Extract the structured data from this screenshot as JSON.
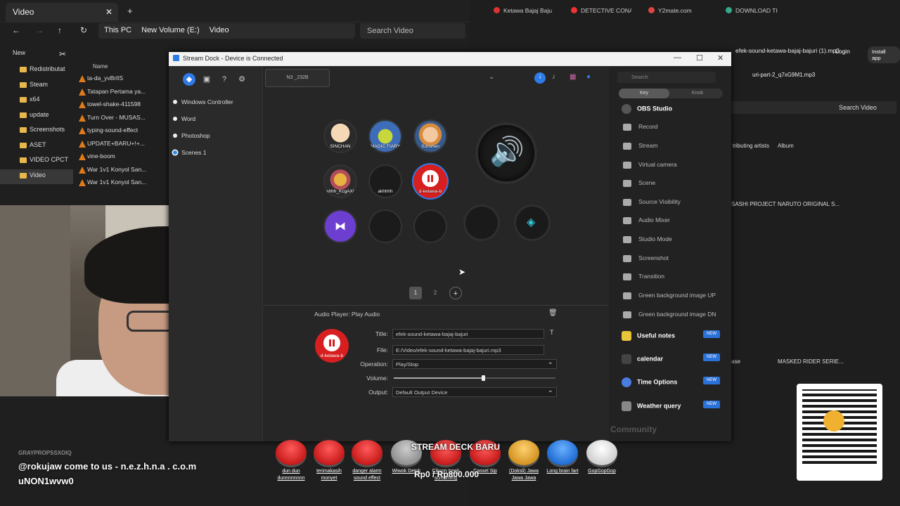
{
  "explorer": {
    "tab": "Video",
    "crumbs": [
      "This PC",
      "New Volume (E:)",
      "Video"
    ],
    "search": "Search Video",
    "new": "New",
    "col_name": "Name",
    "sidebar": [
      "Redistributat",
      "Steam",
      "x64",
      "update",
      "Screenshots",
      "ASET",
      "VIDEO CPCT",
      "Video"
    ],
    "files": [
      "ta-da_yvBrlIS",
      "Tatapan Pertama ya...",
      "towel-shake-411598",
      "Turn Over - MUSAS...",
      "typing-sound-effect",
      "UPDATE+BARU+!+...",
      "vine-boom",
      "War 1v1 Konyol San...",
      "War 1v1 Konyol San..."
    ]
  },
  "chrome": {
    "tabs": [
      "Ketawa Bajaj Baju",
      "DETECTIVE CONA",
      "Y2mate.com",
      "DOWNLOAD TI"
    ],
    "login": "Login",
    "install": "Install app",
    "downloads": [
      "efek-sound-ketawa-bajaj-bajuri (1).mp3",
      "uri-part-2_q7xG9M1.mp3"
    ],
    "search": "Search Video",
    "cols": [
      "tributing artists",
      "Album"
    ],
    "rows": [
      [
        "SASHI PROJECT",
        "NARUTO ORIGINAL S..."
      ],
      [
        "ase",
        "MASKED RIDER SERIE..."
      ]
    ]
  },
  "dock": {
    "title": "Stream Dock - Device is Connected",
    "device": "N3 _232B",
    "profiles": [
      "Windows Controller",
      "Word",
      "Photoshop",
      "Scenes 1"
    ],
    "keys": [
      "SINCHAN",
      "MAGIC FIARY",
      "Sunshen",
      "shhh_KcgAX!",
      "akhhhh",
      "d-ketawa-b"
    ],
    "pages": [
      "1",
      "2",
      "+"
    ],
    "action_header": "Audio Player: Play Audio",
    "props": {
      "title_label": "Title:",
      "title": "efek-sound-ketawa-bajaj-bajuri",
      "file_label": "File:",
      "file": "E:/Video/efek-sound-ketawa-bajaj-bajuri.mp3",
      "op_label": "Operation:",
      "op": "Play/Stop",
      "vol_label": "Volume:",
      "volume": 0.55,
      "out_label": "Output:",
      "output": "Default Output Device"
    },
    "preview_label": "d-ketawa-b",
    "right": {
      "search": "Search",
      "key": "Key",
      "knob": "Knob",
      "section": "OBS Studio",
      "items": [
        "Record",
        "Stream",
        "Virtual camera",
        "Scene",
        "Source Visibility",
        "Audio Mixer",
        "Studio Mode",
        "Screenshot",
        "Transition",
        "Green background image UP",
        "Green background image DN"
      ],
      "cats": [
        "Useful notes",
        "calendar",
        "Time Options",
        "Weather query"
      ],
      "new": "NEW",
      "community": "Community"
    }
  },
  "overlay": {
    "chat_user": "GRAYPROPSSXOIQ",
    "chat_line1": "@rokujaw come to us - n.e.z.h.n.a . c.o.m",
    "chat_line2": "uNON1wvw0",
    "promo": "STREAM DECK BARU",
    "price": "Rp0 / Rp800.000",
    "buttons": [
      "dun dun dunnnnnnnn",
      "terimakasih monyet",
      "danger alarm sound effect",
      "Wiwok Detok",
      "Cikson treek screaming",
      "Cassel Sip",
      "(Doksli) Jawa Jawa Jawa",
      "Long brain fart",
      "GopGopGop"
    ]
  }
}
